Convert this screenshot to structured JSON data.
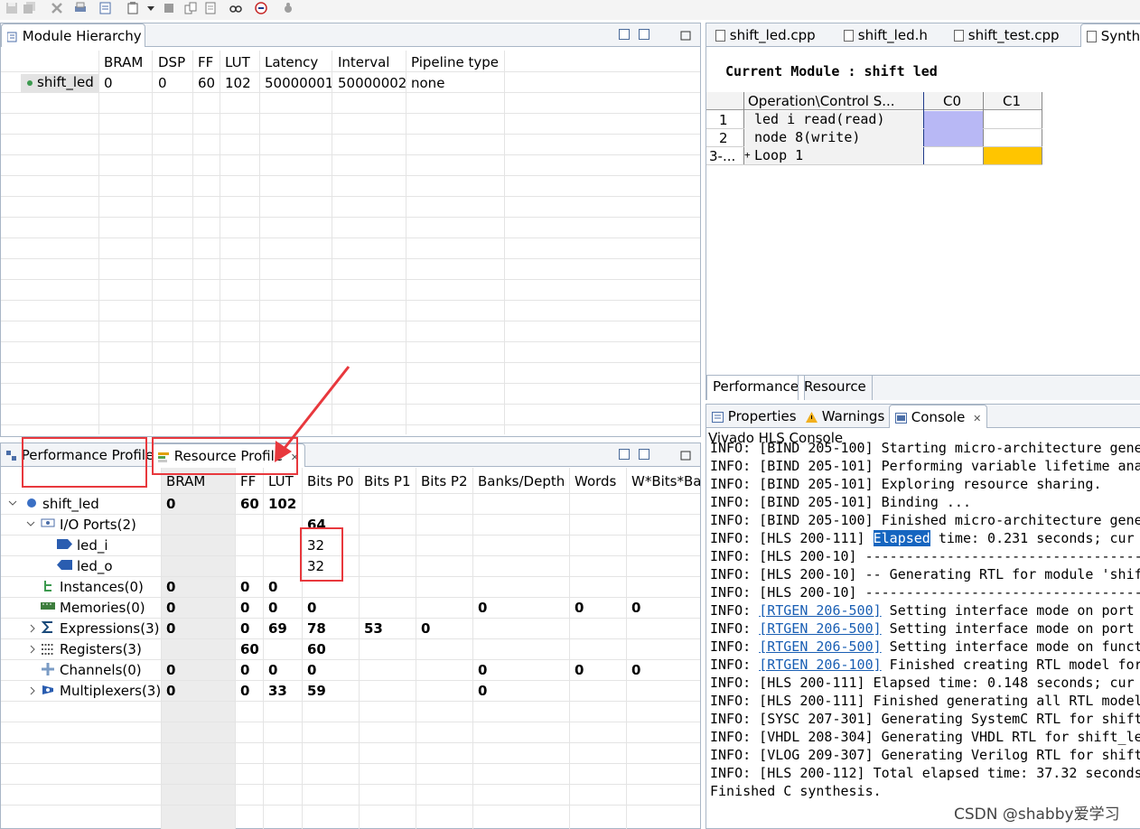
{
  "module_hierarchy": {
    "tab_label": "Module Hierarchy",
    "columns": [
      "BRAM",
      "DSP",
      "FF",
      "LUT",
      "Latency",
      "Interval",
      "Pipeline type"
    ],
    "row": {
      "name": "shift_led",
      "values": [
        "0",
        "0",
        "60",
        "102",
        "50000001",
        "50000002",
        "none"
      ]
    }
  },
  "editor_tabs": [
    "shift_led.cpp",
    "shift_led.h",
    "shift_test.cpp",
    "Synthe"
  ],
  "schedule": {
    "title": "Current Module : shift led",
    "columns": [
      "Operation\\Control S...",
      "C0",
      "C1"
    ],
    "rows": [
      {
        "num": "1",
        "op": "led i read(read)"
      },
      {
        "num": "2",
        "op": "node 8(write)"
      },
      {
        "num": "3-...",
        "op": "Loop 1",
        "expand": "+"
      }
    ],
    "colors": {
      "c0_fill": "#b8b8f5",
      "c1_fill": "#ffc500"
    },
    "bottom_tabs": [
      "Performance",
      "Resource"
    ]
  },
  "profile": {
    "tabs": [
      "Performance Profile",
      "Resource Profile"
    ],
    "columns": [
      "BRAM",
      "FF",
      "LUT",
      "Bits P0",
      "Bits P1",
      "Bits P2",
      "Banks/Depth",
      "Words",
      "W*Bits*Ba"
    ],
    "rows": [
      {
        "name": "shift_led",
        "bram": "0",
        "ff": "60",
        "lut": "102",
        "p0": "",
        "p1": "",
        "p2": "",
        "banks": "",
        "words": "",
        "wbits": ""
      },
      {
        "name": "I/O Ports(2)",
        "bram": "",
        "ff": "",
        "lut": "",
        "p0": "64",
        "p1": "",
        "p2": "",
        "banks": "",
        "words": "",
        "wbits": ""
      },
      {
        "name": "led_i",
        "bram": "",
        "ff": "",
        "lut": "",
        "p0": "32",
        "p1": "",
        "p2": "",
        "banks": "",
        "words": "",
        "wbits": ""
      },
      {
        "name": "led_o",
        "bram": "",
        "ff": "",
        "lut": "",
        "p0": "32",
        "p1": "",
        "p2": "",
        "banks": "",
        "words": "",
        "wbits": ""
      },
      {
        "name": "Instances(0)",
        "bram": "0",
        "ff": "0",
        "lut": "0",
        "p0": "",
        "p1": "",
        "p2": "",
        "banks": "",
        "words": "",
        "wbits": ""
      },
      {
        "name": "Memories(0)",
        "bram": "0",
        "ff": "0",
        "lut": "0",
        "p0": "0",
        "p1": "",
        "p2": "",
        "banks": "0",
        "words": "0",
        "wbits": "0"
      },
      {
        "name": "Expressions(3)",
        "bram": "0",
        "ff": "0",
        "lut": "69",
        "p0": "78",
        "p1": "53",
        "p2": "0",
        "banks": "",
        "words": "",
        "wbits": ""
      },
      {
        "name": "Registers(3)",
        "bram": "",
        "ff": "60",
        "lut": "",
        "p0": "60",
        "p1": "",
        "p2": "",
        "banks": "",
        "words": "",
        "wbits": ""
      },
      {
        "name": "Channels(0)",
        "bram": "0",
        "ff": "0",
        "lut": "0",
        "p0": "0",
        "p1": "",
        "p2": "",
        "banks": "0",
        "words": "0",
        "wbits": "0"
      },
      {
        "name": "Multiplexers(3)",
        "bram": "0",
        "ff": "0",
        "lut": "33",
        "p0": "59",
        "p1": "",
        "p2": "",
        "banks": "0",
        "words": "",
        "wbits": ""
      }
    ]
  },
  "console": {
    "tabs": [
      "Properties",
      "Warnings",
      "Console"
    ],
    "title": "Vivado HLS Console",
    "lines": [
      {
        "pre": "INFO: [BIND 205-100] Starting micro-architecture gene",
        "link": "",
        "post": ""
      },
      {
        "pre": "INFO: [BIND 205-101] Performing variable lifetime ana",
        "link": "",
        "post": ""
      },
      {
        "pre": "INFO: [BIND 205-101] Exploring resource sharing.",
        "link": "",
        "post": ""
      },
      {
        "pre": "INFO: [BIND 205-101] Binding ...",
        "link": "",
        "post": ""
      },
      {
        "pre": "INFO: [BIND 205-100] Finished micro-architecture gene",
        "link": "",
        "post": ""
      },
      {
        "pre": "INFO: [HLS 200-111]  ",
        "sel": "Elapsed",
        "post": " time: 0.231 seconds; cur"
      },
      {
        "pre": "INFO: [HLS 200-10] ----------------------------------",
        "link": "",
        "post": ""
      },
      {
        "pre": "INFO: [HLS 200-10] -- Generating RTL for module 'shif",
        "link": "",
        "post": ""
      },
      {
        "pre": "INFO: [HLS 200-10] ----------------------------------",
        "link": "",
        "post": ""
      },
      {
        "pre": "INFO: ",
        "link": "[RTGEN 206-500]",
        "post": " Setting interface mode on port"
      },
      {
        "pre": "INFO: ",
        "link": "[RTGEN 206-500]",
        "post": " Setting interface mode on port"
      },
      {
        "pre": "INFO: ",
        "link": "[RTGEN 206-500]",
        "post": " Setting interface mode on funct"
      },
      {
        "pre": "INFO: ",
        "link": "[RTGEN 206-100]",
        "post": " Finished creating RTL model for"
      },
      {
        "pre": "INFO: [HLS 200-111]  Elapsed time: 0.148 seconds; cur",
        "link": "",
        "post": ""
      },
      {
        "pre": "INFO: [HLS 200-111] Finished generating all RTL model",
        "link": "",
        "post": ""
      },
      {
        "pre": "INFO: [SYSC 207-301] Generating SystemC RTL for shift",
        "link": "",
        "post": ""
      },
      {
        "pre": "INFO: [VHDL 208-304] Generating VHDL RTL for shift_le",
        "link": "",
        "post": ""
      },
      {
        "pre": "INFO: [VLOG 209-307] Generating Verilog RTL for shift",
        "link": "",
        "post": ""
      },
      {
        "pre": "INFO: [HLS 200-112] Total elapsed time: 37.32 seconds",
        "link": "",
        "post": ""
      },
      {
        "pre": "Finished C synthesis.",
        "link": "",
        "post": ""
      }
    ]
  },
  "watermark": "CSDN @shabby爱学习",
  "accent_colors": {
    "annotation_red": "#e8383d",
    "port_blue": "#2a5db0"
  }
}
